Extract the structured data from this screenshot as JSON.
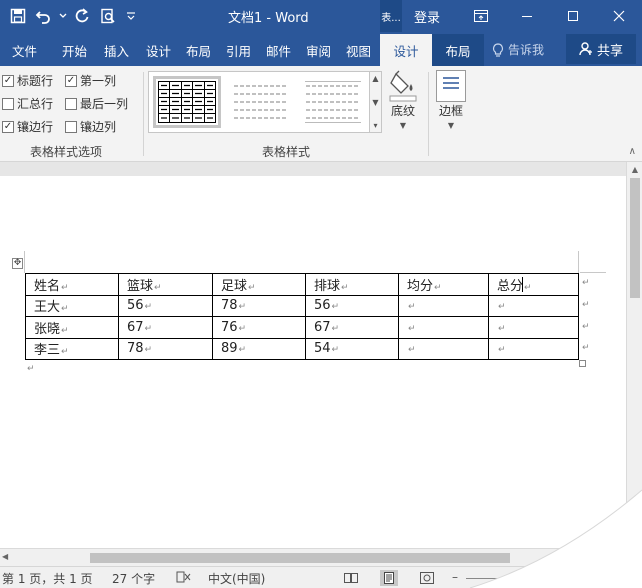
{
  "title_bar": {
    "doc_title": "文档1  -  Word",
    "context_tag": "表...",
    "login_label": "登录"
  },
  "tabs": [
    "文件",
    "开始",
    "插入",
    "设计",
    "布局",
    "引用",
    "邮件",
    "审阅",
    "视图"
  ],
  "context_tabs": [
    "设计",
    "布局"
  ],
  "tell_me": "告诉我",
  "share_label": "共享",
  "ribbon": {
    "options": [
      {
        "label": "标题行",
        "checked": true
      },
      {
        "label": "第一列",
        "checked": true
      },
      {
        "label": "汇总行",
        "checked": false
      },
      {
        "label": "最后一列",
        "checked": false
      },
      {
        "label": "镶边行",
        "checked": true
      },
      {
        "label": "镶边列",
        "checked": false
      }
    ],
    "group_options_label": "表格样式选项",
    "group_styles_label": "表格样式",
    "shading_label": "底纹",
    "borders_label": "边框"
  },
  "table": {
    "header": [
      "姓名",
      "篮球",
      "足球",
      "排球",
      "均分",
      "总分"
    ],
    "rows": [
      [
        "王大",
        "56",
        "78",
        "56",
        "",
        ""
      ],
      [
        "张晓",
        "67",
        "76",
        "67",
        "",
        ""
      ],
      [
        "李三",
        "78",
        "89",
        "54",
        "",
        ""
      ]
    ]
  },
  "status": {
    "page": "第 1 页，共 1 页",
    "words": "27 个字",
    "language": "中文(中国)"
  },
  "colors": {
    "accent": "#2b579a",
    "accent_dark": "#1e4a87",
    "ribbon_bg": "#f3f3f3"
  }
}
